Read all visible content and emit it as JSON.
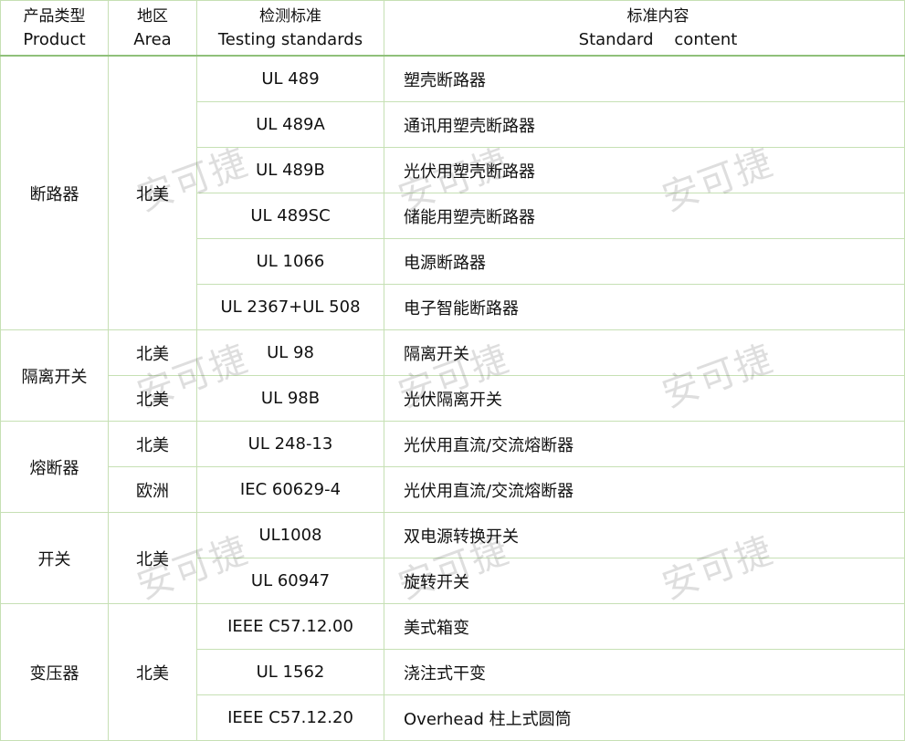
{
  "headers": {
    "product": {
      "cn": "产品类型",
      "en": "Product"
    },
    "area": {
      "cn": "地区",
      "en": "Area"
    },
    "standard": {
      "cn": "检测标准",
      "en": "Testing standards"
    },
    "content": {
      "cn": "标准内容",
      "en": "Standard    content"
    }
  },
  "groups": [
    {
      "product": "断路器",
      "rows": [
        {
          "area": "北美",
          "standard": "UL 489",
          "content": "塑壳断路器"
        },
        {
          "standard": "UL 489A",
          "content": "通讯用塑壳断路器"
        },
        {
          "standard": "UL 489B",
          "content": "光伏用塑壳断路器"
        },
        {
          "standard": "UL 489SC",
          "content": "储能用塑壳断路器"
        },
        {
          "standard": "UL 1066",
          "content": "电源断路器"
        },
        {
          "standard": "UL 2367+UL 508",
          "content": "电子智能断路器"
        }
      ]
    },
    {
      "product": "隔离开关",
      "rows": [
        {
          "area": "北美",
          "standard": "UL 98",
          "content": "隔离开关"
        },
        {
          "area": "北美",
          "standard": "UL 98B",
          "content": "光伏隔离开关"
        }
      ]
    },
    {
      "product": "熔断器",
      "rows": [
        {
          "area": "北美",
          "standard": "UL 248-13",
          "content": "光伏用直流/交流熔断器"
        },
        {
          "area": "欧洲",
          "standard": "IEC 60629-4",
          "content": "光伏用直流/交流熔断器"
        }
      ]
    },
    {
      "product": "开关",
      "rows": [
        {
          "area": "北美",
          "standard": "UL1008",
          "content": "双电源转换开关"
        },
        {
          "standard": "UL 60947",
          "content": "旋转开关"
        }
      ]
    },
    {
      "product": "变压器",
      "rows": [
        {
          "area": "北美",
          "standard": "IEEE C57.12.00",
          "content": "美式箱变"
        },
        {
          "standard": "UL 1562",
          "content": "浇注式干变"
        },
        {
          "standard": "IEEE C57.12.20",
          "content": "Overhead 柱上式圆筒"
        }
      ]
    }
  ],
  "watermark": "安可捷",
  "colors": {
    "grid": "#c6e0b4",
    "header_rule": "#8fc07a"
  }
}
